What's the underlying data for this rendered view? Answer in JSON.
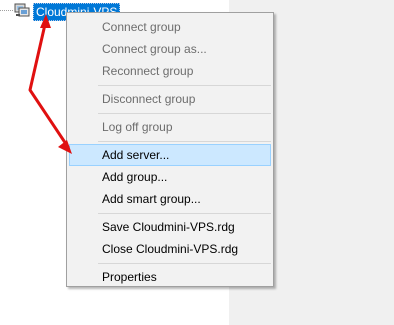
{
  "tree": {
    "root_label": "Cloudmini-VPS",
    "icon": "server-group-icon"
  },
  "context_menu": {
    "items": [
      {
        "label": "Connect group",
        "enabled": false
      },
      {
        "label": "Connect group as...",
        "enabled": false
      },
      {
        "label": "Reconnect group",
        "enabled": false
      },
      {
        "label": "Disconnect group",
        "enabled": false
      },
      {
        "label": "Log off group",
        "enabled": false
      },
      {
        "label": "Add server...",
        "enabled": true,
        "highlighted": true
      },
      {
        "label": "Add group...",
        "enabled": true
      },
      {
        "label": "Add smart group...",
        "enabled": true
      },
      {
        "label": "Save Cloudmini-VPS.rdg",
        "enabled": true
      },
      {
        "label": "Close Cloudmini-VPS.rdg",
        "enabled": true
      },
      {
        "label": "Properties",
        "enabled": true
      }
    ]
  },
  "colors": {
    "selection": "#0078d7",
    "highlight": "#cce8ff",
    "annotation_arrow": "#e01010"
  }
}
